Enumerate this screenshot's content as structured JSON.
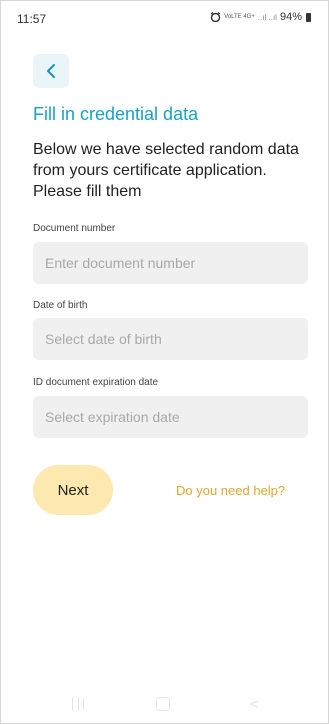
{
  "status_bar": {
    "time": "11:57",
    "indicators_small": "VoLTE 4G+",
    "signal": "..ıl ..ıl",
    "battery": "94%"
  },
  "header": {
    "back_icon": "chevron-left-icon",
    "title": "Fill in credential data"
  },
  "intro_text": "Below we have selected random data from yours certificate application. Please fill them",
  "form": {
    "document_number": {
      "label": "Document number",
      "placeholder": "Enter document number",
      "value": ""
    },
    "date_of_birth": {
      "label": "Date of birth",
      "placeholder": "Select date of birth",
      "value": ""
    },
    "expiration_date": {
      "label": "ID document expiration date",
      "placeholder": "Select expiration date",
      "value": ""
    }
  },
  "actions": {
    "next_label": "Next",
    "help_label": "Do you need help?"
  },
  "colors": {
    "accent": "#1aa3bf",
    "button_bg": "#fde8b0",
    "link": "#e0a82e",
    "field_bg": "#f0f0f0"
  }
}
